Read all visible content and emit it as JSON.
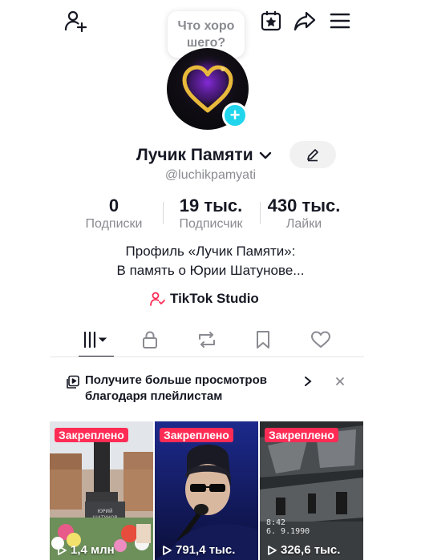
{
  "header": {
    "bubble_line1": "Что хоро",
    "bubble_line2": "шего?"
  },
  "profile": {
    "display_name": "Лучик Памяти",
    "username": "@luchikpamyati",
    "bio_line1": "Профиль «Лучик Памяти»:",
    "bio_line2": "В память о Юрии Шатунове..."
  },
  "stats": [
    {
      "value": "0",
      "label": "Подписки"
    },
    {
      "value": "19 тыс.",
      "label": "Подписчик"
    },
    {
      "value": "430 тыс.",
      "label": "Лайки"
    }
  ],
  "studio": {
    "label": "TikTok Studio"
  },
  "promo": {
    "text": "Получите больше просмотров благодаря плейлистам"
  },
  "videos": [
    {
      "badge": "Закреплено",
      "views": "1,4 млн"
    },
    {
      "badge": "Закреплено",
      "views": "791,4 тыс."
    },
    {
      "badge": "Закреплено",
      "views": "326,6 тыс.",
      "stamp_line1": "8:42",
      "stamp_line2": "6. 9.1990"
    }
  ],
  "colors": {
    "accent": "#fe2c55",
    "cyan": "#20d5ec",
    "heart": "#e8b93a"
  }
}
